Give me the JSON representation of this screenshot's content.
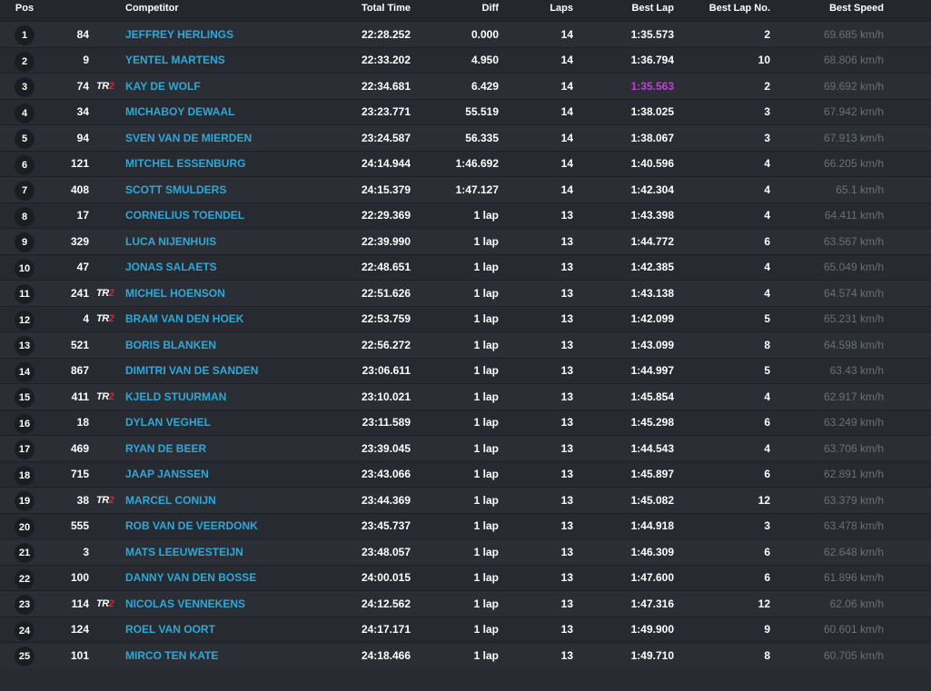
{
  "columns": {
    "pos": "Pos",
    "competitor": "Competitor",
    "total_time": "Total Time",
    "diff": "Diff",
    "laps": "Laps",
    "best_lap": "Best Lap",
    "best_lap_no": "Best Lap No.",
    "best_speed": "Best Speed"
  },
  "accent_colors": {
    "name": "#2fa8d8",
    "fastest_lap": "#c040d8",
    "badge_red": "#e4232b"
  },
  "badge_text": {
    "tr": "TR",
    "two": "2"
  },
  "rows": [
    {
      "pos": "1",
      "num": "84",
      "badge": false,
      "name": "JEFFREY HERLINGS",
      "total": "22:28.252",
      "diff": "0.000",
      "laps": "14",
      "best": "1:35.573",
      "best_no": "2",
      "speed": "69.685 km/h",
      "fastest": false
    },
    {
      "pos": "2",
      "num": "9",
      "badge": false,
      "name": "YENTEL MARTENS",
      "total": "22:33.202",
      "diff": "4.950",
      "laps": "14",
      "best": "1:36.794",
      "best_no": "10",
      "speed": "68.806 km/h",
      "fastest": false
    },
    {
      "pos": "3",
      "num": "74",
      "badge": true,
      "name": "KAY DE WOLF",
      "total": "22:34.681",
      "diff": "6.429",
      "laps": "14",
      "best": "1:35.563",
      "best_no": "2",
      "speed": "69.692 km/h",
      "fastest": true
    },
    {
      "pos": "4",
      "num": "34",
      "badge": false,
      "name": "MICHABOY DEWAAL",
      "total": "23:23.771",
      "diff": "55.519",
      "laps": "14",
      "best": "1:38.025",
      "best_no": "3",
      "speed": "67.942 km/h",
      "fastest": false
    },
    {
      "pos": "5",
      "num": "94",
      "badge": false,
      "name": "SVEN VAN DE MIERDEN",
      "total": "23:24.587",
      "diff": "56.335",
      "laps": "14",
      "best": "1:38.067",
      "best_no": "3",
      "speed": "67.913 km/h",
      "fastest": false
    },
    {
      "pos": "6",
      "num": "121",
      "badge": false,
      "name": "MITCHEL ESSENBURG",
      "total": "24:14.944",
      "diff": "1:46.692",
      "laps": "14",
      "best": "1:40.596",
      "best_no": "4",
      "speed": "66.205 km/h",
      "fastest": false
    },
    {
      "pos": "7",
      "num": "408",
      "badge": false,
      "name": "SCOTT SMULDERS",
      "total": "24:15.379",
      "diff": "1:47.127",
      "laps": "14",
      "best": "1:42.304",
      "best_no": "4",
      "speed": "65.1 km/h",
      "fastest": false
    },
    {
      "pos": "8",
      "num": "17",
      "badge": false,
      "name": "CORNELIUS TOENDEL",
      "total": "22:29.369",
      "diff": "1 lap",
      "laps": "13",
      "best": "1:43.398",
      "best_no": "4",
      "speed": "64.411 km/h",
      "fastest": false
    },
    {
      "pos": "9",
      "num": "329",
      "badge": false,
      "name": "LUCA NIJENHUIS",
      "total": "22:39.990",
      "diff": "1 lap",
      "laps": "13",
      "best": "1:44.772",
      "best_no": "6",
      "speed": "63.567 km/h",
      "fastest": false
    },
    {
      "pos": "10",
      "num": "47",
      "badge": false,
      "name": "JONAS SALAETS",
      "total": "22:48.651",
      "diff": "1 lap",
      "laps": "13",
      "best": "1:42.385",
      "best_no": "4",
      "speed": "65.049 km/h",
      "fastest": false
    },
    {
      "pos": "11",
      "num": "241",
      "badge": true,
      "name": "MICHEL HOENSON",
      "total": "22:51.626",
      "diff": "1 lap",
      "laps": "13",
      "best": "1:43.138",
      "best_no": "4",
      "speed": "64.574 km/h",
      "fastest": false
    },
    {
      "pos": "12",
      "num": "4",
      "badge": true,
      "name": "BRAM VAN DEN HOEK",
      "total": "22:53.759",
      "diff": "1 lap",
      "laps": "13",
      "best": "1:42.099",
      "best_no": "5",
      "speed": "65.231 km/h",
      "fastest": false
    },
    {
      "pos": "13",
      "num": "521",
      "badge": false,
      "name": "BORIS BLANKEN",
      "total": "22:56.272",
      "diff": "1 lap",
      "laps": "13",
      "best": "1:43.099",
      "best_no": "8",
      "speed": "64.598 km/h",
      "fastest": false
    },
    {
      "pos": "14",
      "num": "867",
      "badge": false,
      "name": "DIMITRI VAN DE SANDEN",
      "total": "23:06.611",
      "diff": "1 lap",
      "laps": "13",
      "best": "1:44.997",
      "best_no": "5",
      "speed": "63.43 km/h",
      "fastest": false
    },
    {
      "pos": "15",
      "num": "411",
      "badge": true,
      "name": "KJELD STUURMAN",
      "total": "23:10.021",
      "diff": "1 lap",
      "laps": "13",
      "best": "1:45.854",
      "best_no": "4",
      "speed": "62.917 km/h",
      "fastest": false
    },
    {
      "pos": "16",
      "num": "18",
      "badge": false,
      "name": "DYLAN VEGHEL",
      "total": "23:11.589",
      "diff": "1 lap",
      "laps": "13",
      "best": "1:45.298",
      "best_no": "6",
      "speed": "63.249 km/h",
      "fastest": false
    },
    {
      "pos": "17",
      "num": "469",
      "badge": false,
      "name": "RYAN DE BEER",
      "total": "23:39.045",
      "diff": "1 lap",
      "laps": "13",
      "best": "1:44.543",
      "best_no": "4",
      "speed": "63.706 km/h",
      "fastest": false
    },
    {
      "pos": "18",
      "num": "715",
      "badge": false,
      "name": "JAAP JANSSEN",
      "total": "23:43.066",
      "diff": "1 lap",
      "laps": "13",
      "best": "1:45.897",
      "best_no": "6",
      "speed": "62.891 km/h",
      "fastest": false
    },
    {
      "pos": "19",
      "num": "38",
      "badge": true,
      "name": "MARCEL CONIJN",
      "total": "23:44.369",
      "diff": "1 lap",
      "laps": "13",
      "best": "1:45.082",
      "best_no": "12",
      "speed": "63.379 km/h",
      "fastest": false
    },
    {
      "pos": "20",
      "num": "555",
      "badge": false,
      "name": "ROB VAN DE VEERDONK",
      "total": "23:45.737",
      "diff": "1 lap",
      "laps": "13",
      "best": "1:44.918",
      "best_no": "3",
      "speed": "63.478 km/h",
      "fastest": false
    },
    {
      "pos": "21",
      "num": "3",
      "badge": false,
      "name": "MATS LEEUWESTEIJN",
      "total": "23:48.057",
      "diff": "1 lap",
      "laps": "13",
      "best": "1:46.309",
      "best_no": "6",
      "speed": "62.648 km/h",
      "fastest": false
    },
    {
      "pos": "22",
      "num": "100",
      "badge": false,
      "name": "DANNY VAN DEN BOSSE",
      "total": "24:00.015",
      "diff": "1 lap",
      "laps": "13",
      "best": "1:47.600",
      "best_no": "6",
      "speed": "61.896 km/h",
      "fastest": false
    },
    {
      "pos": "23",
      "num": "114",
      "badge": true,
      "name": "NICOLAS VENNEKENS",
      "total": "24:12.562",
      "diff": "1 lap",
      "laps": "13",
      "best": "1:47.316",
      "best_no": "12",
      "speed": "62.06 km/h",
      "fastest": false
    },
    {
      "pos": "24",
      "num": "124",
      "badge": false,
      "name": "ROEL VAN OORT",
      "total": "24:17.171",
      "diff": "1 lap",
      "laps": "13",
      "best": "1:49.900",
      "best_no": "9",
      "speed": "60.601 km/h",
      "fastest": false
    },
    {
      "pos": "25",
      "num": "101",
      "badge": false,
      "name": "MIRCO TEN KATE",
      "total": "24:18.466",
      "diff": "1 lap",
      "laps": "13",
      "best": "1:49.710",
      "best_no": "8",
      "speed": "60.705 km/h",
      "fastest": false
    }
  ]
}
